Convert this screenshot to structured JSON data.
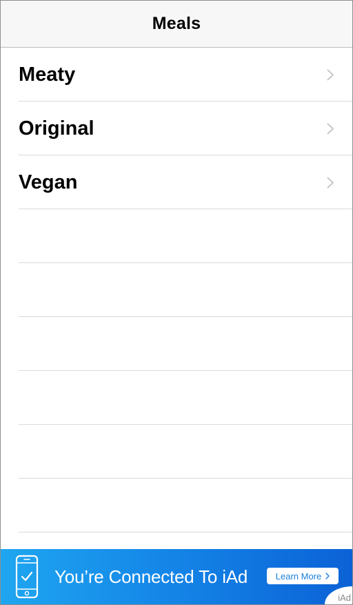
{
  "navbar": {
    "title": "Meals"
  },
  "meals": {
    "items": [
      {
        "label": "Meaty"
      },
      {
        "label": "Original"
      },
      {
        "label": "Vegan"
      }
    ],
    "empty_rows": 6
  },
  "ad": {
    "text": "You’re Connected To iAd",
    "button_label": "Learn More",
    "badge": "iAd",
    "icons": [
      "phone-check-icon",
      "chevron-right-icon"
    ]
  },
  "colors": {
    "ad_start": "#1fa6f0",
    "ad_end": "#0b62d6",
    "chevron": "#c7c7cc",
    "separator": "#d9d9d9"
  }
}
